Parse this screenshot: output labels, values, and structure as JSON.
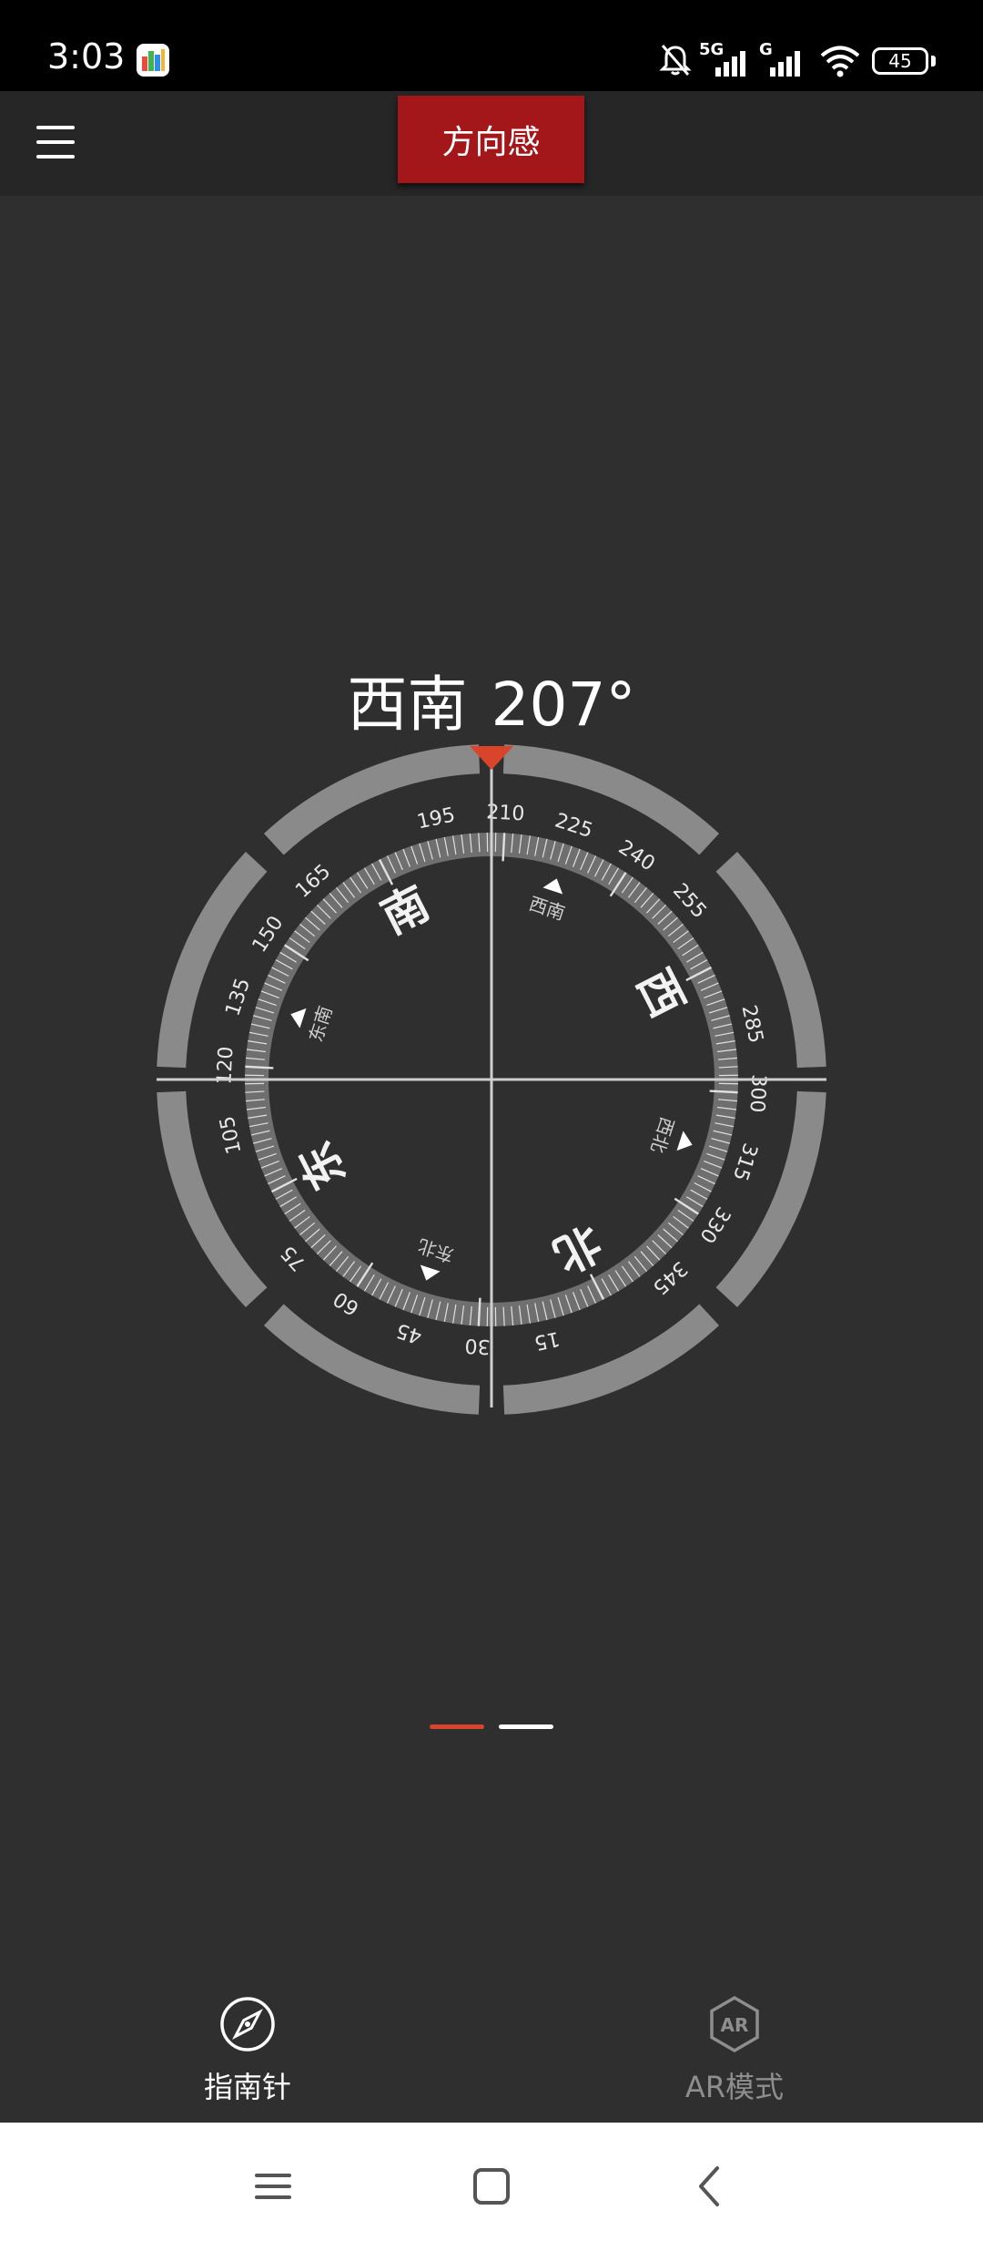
{
  "status_bar": {
    "time": "3:03",
    "network_1": "5G",
    "network_2": "G",
    "battery": "45"
  },
  "app_bar": {
    "title": "方向感"
  },
  "heading": {
    "direction": "西南",
    "degrees": "207°"
  },
  "compass": {
    "heading_degrees": 207,
    "cardinals": {
      "north": "北",
      "south": "南",
      "east": "东",
      "west": "西"
    },
    "intercardinals": {
      "northeast": "东北",
      "southeast": "东南",
      "southwest": "西南",
      "northwest": "西北"
    },
    "tick_labels": [
      "15",
      "30",
      "45",
      "60",
      "75",
      "105",
      "120",
      "135",
      "150",
      "165",
      "195",
      "210",
      "225",
      "240",
      "255",
      "285",
      "300",
      "315",
      "330",
      "345"
    ],
    "accent_color": "#d9452b"
  },
  "page_indicator": {
    "count": 2,
    "active": 1
  },
  "bottom_nav": {
    "items": [
      {
        "label": "指南针",
        "icon": "compass-icon",
        "active": true
      },
      {
        "label": "AR模式",
        "icon": "ar-icon",
        "active": false
      }
    ]
  },
  "system_nav": {
    "icons": [
      "recents-icon",
      "home-icon",
      "back-icon"
    ]
  }
}
